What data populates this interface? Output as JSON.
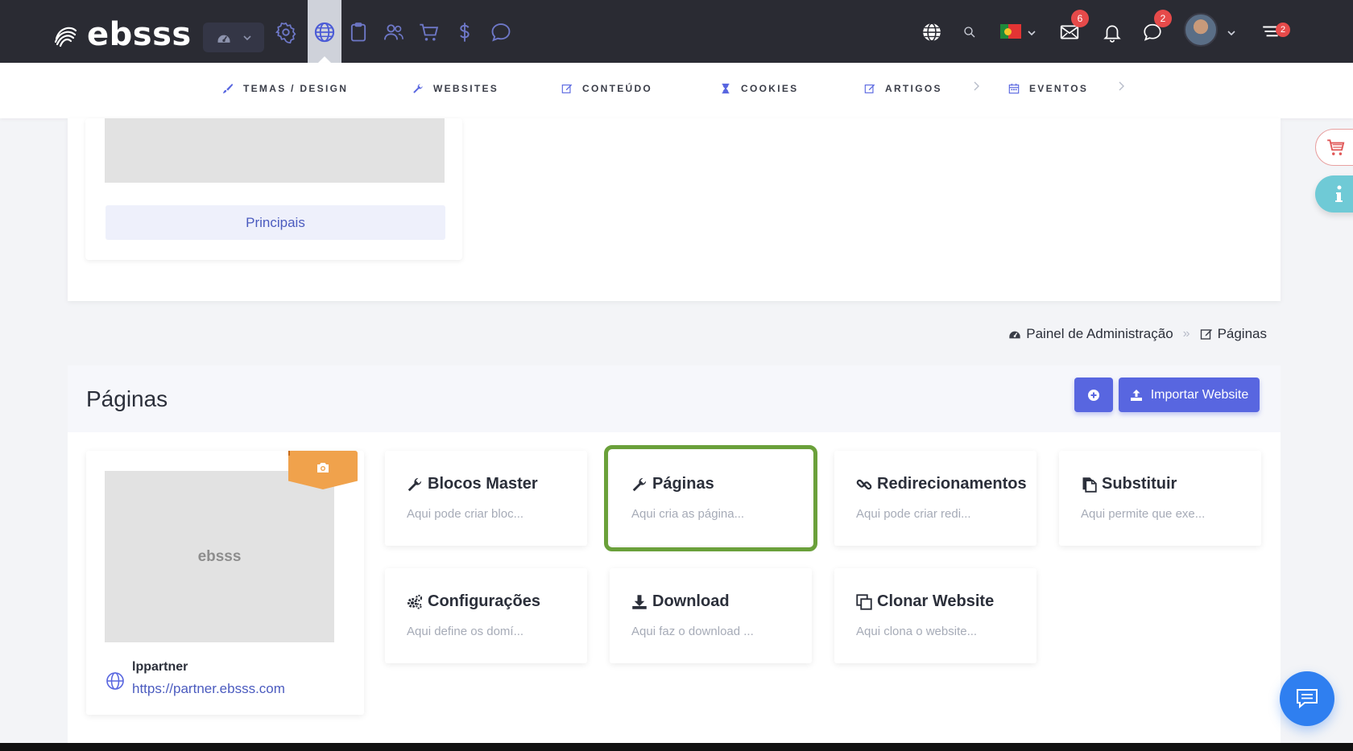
{
  "app": {
    "brand": "ebsss"
  },
  "topbar": {
    "icons": [
      "dashboard-icon",
      "gear-icon",
      "globe-icon",
      "clipboard-icon",
      "users-icon",
      "cart-icon",
      "dollar-icon",
      "chat-icon"
    ],
    "active": "globe-icon",
    "messages_badge": "6",
    "comments_badge": "2",
    "menu_badge": "2",
    "language_flag": "pt"
  },
  "subnav": {
    "items": [
      {
        "label": "TEMAS / DESIGN",
        "icon": "brush-icon"
      },
      {
        "label": "WEBSITES",
        "icon": "wrench-icon"
      },
      {
        "label": "CONTEÚDO",
        "icon": "edit-icon"
      },
      {
        "label": "COOKIES",
        "icon": "hourglass-icon"
      },
      {
        "label": "ARTIGOS",
        "icon": "edit-icon"
      },
      {
        "label": "EVENTOS",
        "icon": "calendar-icon"
      }
    ]
  },
  "upper": {
    "button_label": "Principais"
  },
  "breadcrumb": {
    "home": "Painel de Administração",
    "separator": "»",
    "current": "Páginas"
  },
  "panel": {
    "title": "Páginas",
    "import_label": "Importar Website",
    "site": {
      "thumb_text": "ebsss",
      "name": "lppartner",
      "url": "https://partner.ebsss.com"
    },
    "tiles": [
      {
        "title": "Blocos Master",
        "desc": "Aqui pode criar bloc...",
        "icon": "wrench-icon"
      },
      {
        "title": "Páginas",
        "desc": "Aqui cria as página...",
        "icon": "wrench-icon",
        "highlighted": true
      },
      {
        "title": "Redirecionamentos",
        "desc": "Aqui pode criar redi...",
        "icon": "link-icon"
      },
      {
        "title": "Substituir",
        "desc": "Aqui permite que exe...",
        "icon": "copy-icon"
      },
      {
        "title": "Configurações",
        "desc": "Aqui define os domí...",
        "icon": "cogs-icon"
      },
      {
        "title": "Download",
        "desc": "Aqui faz o download ...",
        "icon": "download-icon"
      },
      {
        "title": "Clonar Website",
        "desc": "Aqui clona o website...",
        "icon": "clone-icon"
      }
    ]
  },
  "colors": {
    "topbar": "#2a2b33",
    "primary": "#5866e0",
    "highlight": "#6aa03a",
    "accent_orange": "#f0a24c",
    "chat": "#2f7ff0"
  }
}
